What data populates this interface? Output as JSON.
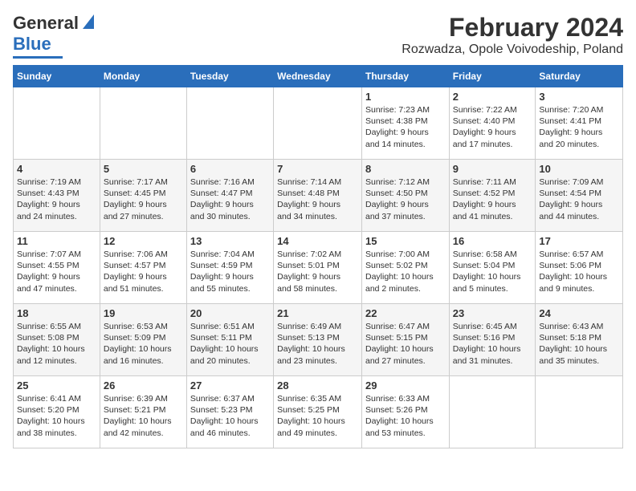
{
  "header": {
    "logo": {
      "line1": "General",
      "line2": "Blue"
    },
    "title": "February 2024",
    "subtitle": "Rozwadza, Opole Voivodeship, Poland"
  },
  "weekdays": [
    "Sunday",
    "Monday",
    "Tuesday",
    "Wednesday",
    "Thursday",
    "Friday",
    "Saturday"
  ],
  "weeks": [
    [
      {
        "day": "",
        "content": ""
      },
      {
        "day": "",
        "content": ""
      },
      {
        "day": "",
        "content": ""
      },
      {
        "day": "",
        "content": ""
      },
      {
        "day": "1",
        "content": "Sunrise: 7:23 AM\nSunset: 4:38 PM\nDaylight: 9 hours\nand 14 minutes."
      },
      {
        "day": "2",
        "content": "Sunrise: 7:22 AM\nSunset: 4:40 PM\nDaylight: 9 hours\nand 17 minutes."
      },
      {
        "day": "3",
        "content": "Sunrise: 7:20 AM\nSunset: 4:41 PM\nDaylight: 9 hours\nand 20 minutes."
      }
    ],
    [
      {
        "day": "4",
        "content": "Sunrise: 7:19 AM\nSunset: 4:43 PM\nDaylight: 9 hours\nand 24 minutes."
      },
      {
        "day": "5",
        "content": "Sunrise: 7:17 AM\nSunset: 4:45 PM\nDaylight: 9 hours\nand 27 minutes."
      },
      {
        "day": "6",
        "content": "Sunrise: 7:16 AM\nSunset: 4:47 PM\nDaylight: 9 hours\nand 30 minutes."
      },
      {
        "day": "7",
        "content": "Sunrise: 7:14 AM\nSunset: 4:48 PM\nDaylight: 9 hours\nand 34 minutes."
      },
      {
        "day": "8",
        "content": "Sunrise: 7:12 AM\nSunset: 4:50 PM\nDaylight: 9 hours\nand 37 minutes."
      },
      {
        "day": "9",
        "content": "Sunrise: 7:11 AM\nSunset: 4:52 PM\nDaylight: 9 hours\nand 41 minutes."
      },
      {
        "day": "10",
        "content": "Sunrise: 7:09 AM\nSunset: 4:54 PM\nDaylight: 9 hours\nand 44 minutes."
      }
    ],
    [
      {
        "day": "11",
        "content": "Sunrise: 7:07 AM\nSunset: 4:55 PM\nDaylight: 9 hours\nand 47 minutes."
      },
      {
        "day": "12",
        "content": "Sunrise: 7:06 AM\nSunset: 4:57 PM\nDaylight: 9 hours\nand 51 minutes."
      },
      {
        "day": "13",
        "content": "Sunrise: 7:04 AM\nSunset: 4:59 PM\nDaylight: 9 hours\nand 55 minutes."
      },
      {
        "day": "14",
        "content": "Sunrise: 7:02 AM\nSunset: 5:01 PM\nDaylight: 9 hours\nand 58 minutes."
      },
      {
        "day": "15",
        "content": "Sunrise: 7:00 AM\nSunset: 5:02 PM\nDaylight: 10 hours\nand 2 minutes."
      },
      {
        "day": "16",
        "content": "Sunrise: 6:58 AM\nSunset: 5:04 PM\nDaylight: 10 hours\nand 5 minutes."
      },
      {
        "day": "17",
        "content": "Sunrise: 6:57 AM\nSunset: 5:06 PM\nDaylight: 10 hours\nand 9 minutes."
      }
    ],
    [
      {
        "day": "18",
        "content": "Sunrise: 6:55 AM\nSunset: 5:08 PM\nDaylight: 10 hours\nand 12 minutes."
      },
      {
        "day": "19",
        "content": "Sunrise: 6:53 AM\nSunset: 5:09 PM\nDaylight: 10 hours\nand 16 minutes."
      },
      {
        "day": "20",
        "content": "Sunrise: 6:51 AM\nSunset: 5:11 PM\nDaylight: 10 hours\nand 20 minutes."
      },
      {
        "day": "21",
        "content": "Sunrise: 6:49 AM\nSunset: 5:13 PM\nDaylight: 10 hours\nand 23 minutes."
      },
      {
        "day": "22",
        "content": "Sunrise: 6:47 AM\nSunset: 5:15 PM\nDaylight: 10 hours\nand 27 minutes."
      },
      {
        "day": "23",
        "content": "Sunrise: 6:45 AM\nSunset: 5:16 PM\nDaylight: 10 hours\nand 31 minutes."
      },
      {
        "day": "24",
        "content": "Sunrise: 6:43 AM\nSunset: 5:18 PM\nDaylight: 10 hours\nand 35 minutes."
      }
    ],
    [
      {
        "day": "25",
        "content": "Sunrise: 6:41 AM\nSunset: 5:20 PM\nDaylight: 10 hours\nand 38 minutes."
      },
      {
        "day": "26",
        "content": "Sunrise: 6:39 AM\nSunset: 5:21 PM\nDaylight: 10 hours\nand 42 minutes."
      },
      {
        "day": "27",
        "content": "Sunrise: 6:37 AM\nSunset: 5:23 PM\nDaylight: 10 hours\nand 46 minutes."
      },
      {
        "day": "28",
        "content": "Sunrise: 6:35 AM\nSunset: 5:25 PM\nDaylight: 10 hours\nand 49 minutes."
      },
      {
        "day": "29",
        "content": "Sunrise: 6:33 AM\nSunset: 5:26 PM\nDaylight: 10 hours\nand 53 minutes."
      },
      {
        "day": "",
        "content": ""
      },
      {
        "day": "",
        "content": ""
      }
    ]
  ]
}
